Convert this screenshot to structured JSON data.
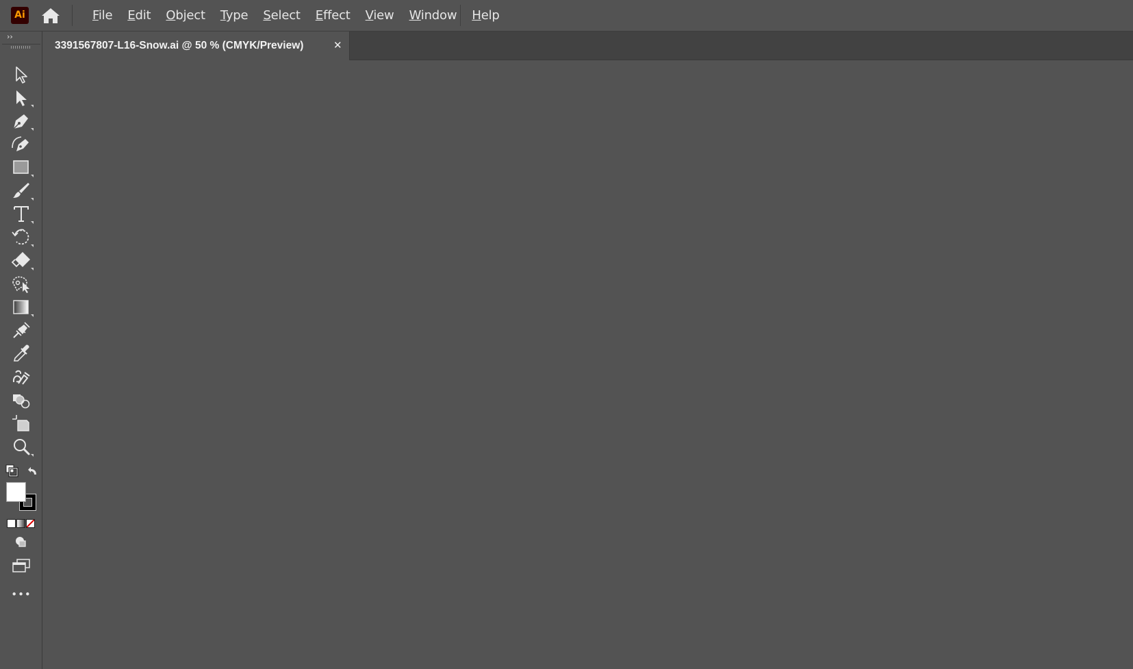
{
  "app": {
    "logo_text": "Ai",
    "home_icon": "home-icon"
  },
  "menu": [
    "File",
    "Edit",
    "Object",
    "Type",
    "Select",
    "Effect",
    "View",
    "Window",
    "Help"
  ],
  "document": {
    "tab_title": "3391567807-L16-Snow.ai @ 50 % (CMYK/Preview)",
    "close_glyph": "✕"
  },
  "toolbar": {
    "collapse_glyph": "››",
    "tools": [
      "selection-tool-icon",
      "direct-selection-tool-icon",
      "pen-tool-icon",
      "curvature-tool-icon",
      "rectangle-tool-icon",
      "paintbrush-tool-icon",
      "type-tool-icon",
      "rotate-tool-icon",
      "eraser-tool-icon",
      "puppet-warp-tool-icon",
      "gradient-tool-icon",
      "blend-tool-icon",
      "eyedropper-tool-icon",
      "symbol-sprayer-tool-icon",
      "shape-builder-tool-icon",
      "artboard-tool-icon",
      "zoom-tool-icon"
    ],
    "fill_color": "#ffffff",
    "stroke_color": "#000000",
    "more_glyph": "•••"
  },
  "colors": {
    "ui_background": "#535353",
    "tabbar_background": "#424242",
    "logo_background": "#330000",
    "logo_text": "#ff9a00"
  }
}
